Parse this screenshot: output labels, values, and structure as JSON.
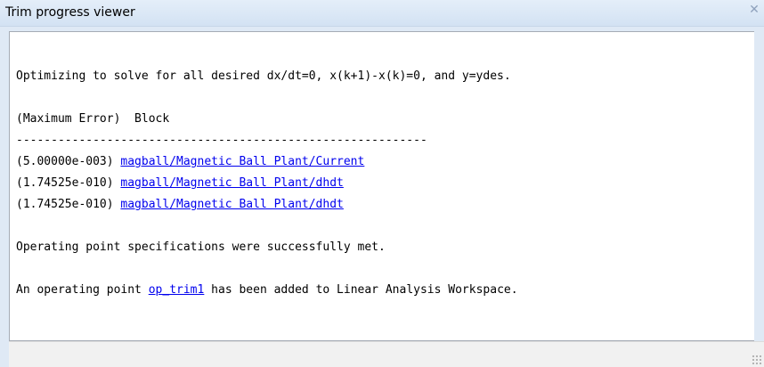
{
  "window": {
    "title": "Trim progress viewer",
    "close_icon": "✕"
  },
  "log": {
    "intro": "Optimizing to solve for all desired dx/dt=0, x(k+1)-x(k)=0, and y=ydes.",
    "header": "(Maximum Error)  Block",
    "separator": "-----------------------------------------------------------",
    "rows": [
      {
        "error": "(5.00000e-003) ",
        "block": "magball/Magnetic Ball Plant/Current"
      },
      {
        "error": "(1.74525e-010) ",
        "block": "magball/Magnetic Ball Plant/dhdt"
      },
      {
        "error": "(1.74525e-010) ",
        "block": "magball/Magnetic Ball Plant/dhdt"
      }
    ],
    "status": "Operating point specifications were successfully met.",
    "result_prefix": "An operating point ",
    "result_link": "op_trim1",
    "result_suffix": " has been added to Linear Analysis Workspace."
  },
  "colors": {
    "link": "#0000ee",
    "titlebar": "#dfe9f5"
  }
}
